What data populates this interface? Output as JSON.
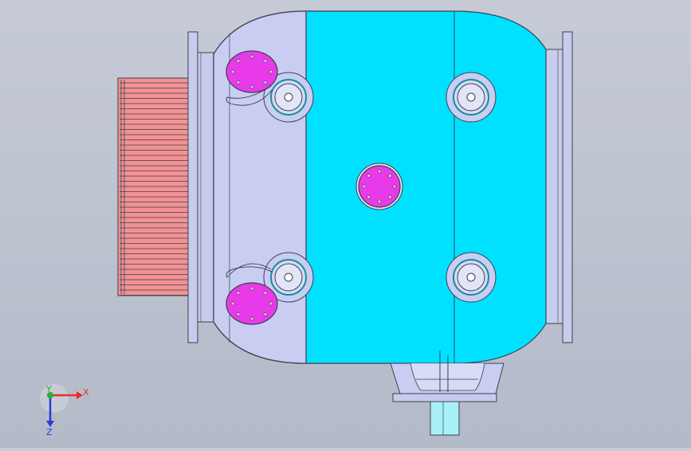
{
  "viewport": {
    "background_top": "#c6cbd6",
    "background_bottom": "#b3bac8"
  },
  "colors": {
    "body_blue": "#00e1ff",
    "body_light": "#c9cdf2",
    "flange": "#c8ccec",
    "heatsink": "#f39292",
    "cover_magenta": "#e83ae8",
    "outline": "#3b3f52",
    "shaft": "#a8f0f8",
    "axis_x": "#e53030",
    "axis_y": "#2ab02a",
    "axis_z": "#2b3ad8"
  },
  "triad": {
    "x_label": "X",
    "y_label": "Y",
    "z_label": "Z"
  },
  "icons": {
    "triad": "coordinate-triad-icon"
  }
}
